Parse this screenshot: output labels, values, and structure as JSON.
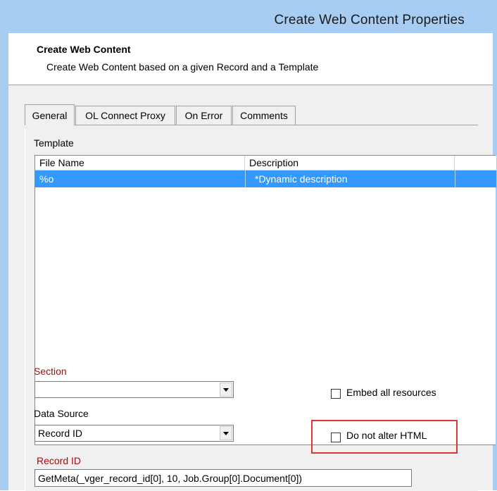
{
  "window": {
    "title": "Create Web Content Properties"
  },
  "header": {
    "title": "Create Web Content",
    "description": "Create Web Content based on a given Record and a Template"
  },
  "tabs": [
    {
      "label": "General",
      "active": true
    },
    {
      "label": "OL Connect Proxy",
      "active": false
    },
    {
      "label": "On Error",
      "active": false
    },
    {
      "label": "Comments",
      "active": false
    }
  ],
  "template": {
    "label": "Template",
    "columns": [
      "File Name",
      "Description"
    ],
    "rows": [
      {
        "file_name": "%o",
        "description": "*Dynamic description",
        "selected": true
      }
    ]
  },
  "section": {
    "label": "Section",
    "value": ""
  },
  "data_source": {
    "label": "Data Source",
    "value": "Record ID"
  },
  "embed_all_resources": {
    "label": "Embed all resources",
    "checked": false
  },
  "do_not_alter_html": {
    "label": "Do not alter HTML",
    "checked": false
  },
  "record_id": {
    "label": "Record ID",
    "value": "GetMeta(_vger_record_id[0], 10, Job.Group[0].Document[0])"
  },
  "colors": {
    "titlebar": "#a8cdf2",
    "selection": "#3399ff",
    "required_label": "#a30c0c",
    "highlight_box": "#e03535"
  }
}
